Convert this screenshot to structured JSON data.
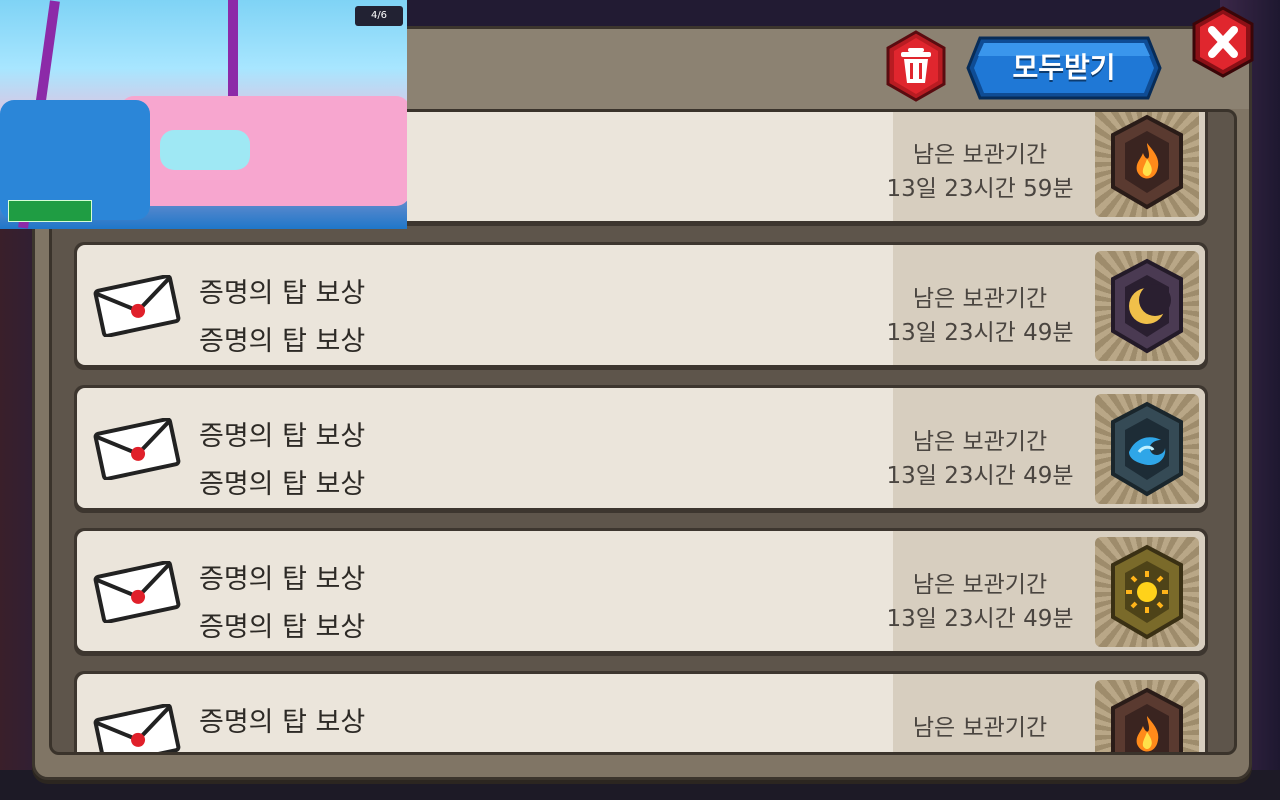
{
  "header": {
    "receive_all_label": "모두받기"
  },
  "colors": {
    "receive_btn": "#1a6fd0",
    "trash_btn": "#d2232a",
    "close_btn": "#d2232a",
    "row_bg": "#ebe5db",
    "panel_bg": "#807565"
  },
  "video_overlay": {
    "status_text": "4/6"
  },
  "mail": {
    "items": [
      {
        "title": "",
        "sub": "",
        "expire_label": "남은 보관기간",
        "expire_time": "13일 23시간 59분",
        "reward_icon": "fire-gem-icon"
      },
      {
        "title": "증명의 탑 보상",
        "sub": "증명의 탑 보상",
        "expire_label": "남은 보관기간",
        "expire_time": "13일 23시간 49분",
        "reward_icon": "moon-gem-icon"
      },
      {
        "title": "증명의 탑 보상",
        "sub": "증명의 탑 보상",
        "expire_label": "남은 보관기간",
        "expire_time": "13일 23시간 49분",
        "reward_icon": "water-gem-icon"
      },
      {
        "title": "증명의 탑 보상",
        "sub": "증명의 탑 보상",
        "expire_label": "남은 보관기간",
        "expire_time": "13일 23시간 49분",
        "reward_icon": "sun-gem-icon"
      },
      {
        "title": "증명의 탑 보상",
        "sub": "",
        "expire_label": "남은 보관기간",
        "expire_time": "",
        "reward_icon": "fire-gem-icon"
      }
    ]
  }
}
